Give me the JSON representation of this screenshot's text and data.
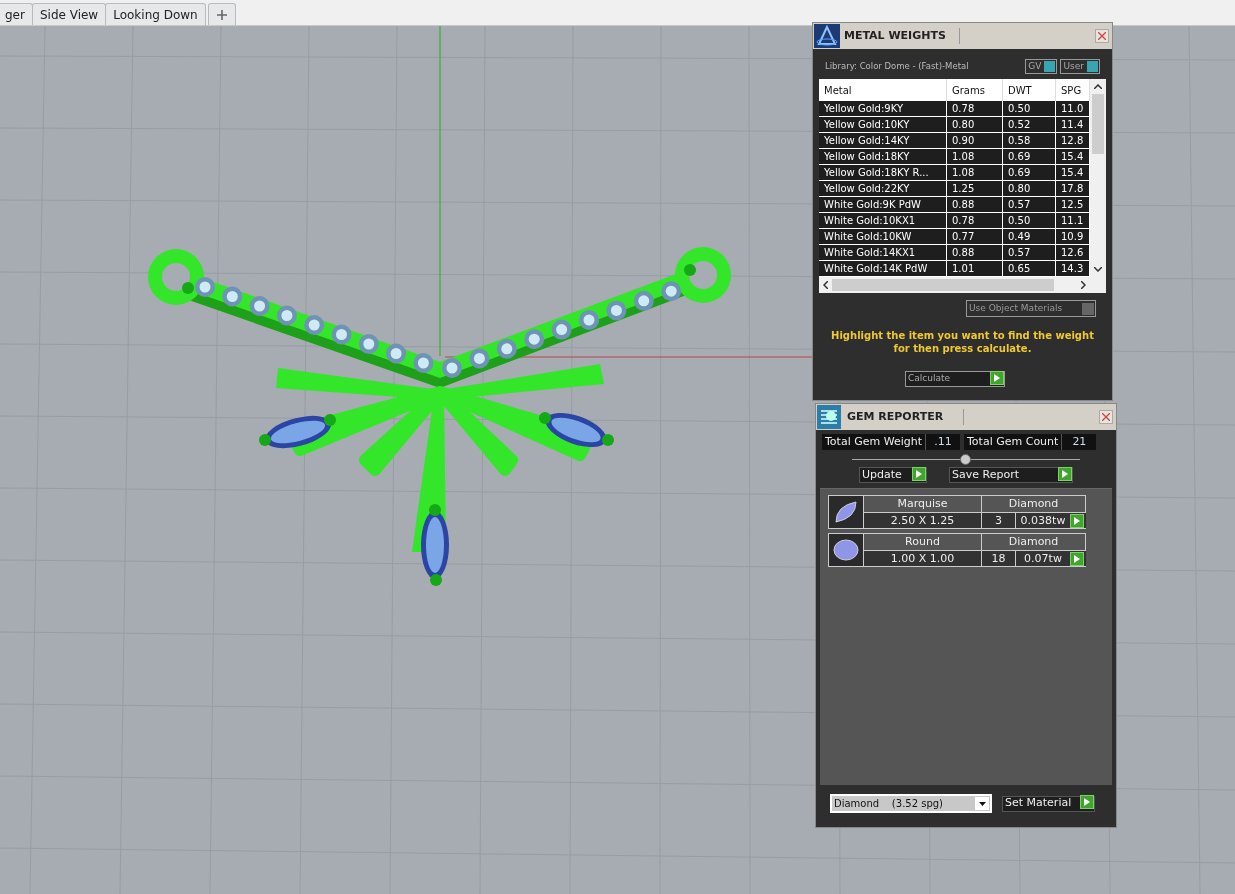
{
  "tabs": [
    {
      "label": "ger"
    },
    {
      "label": "Side View"
    },
    {
      "label": "Looking Down"
    }
  ],
  "metal_weights": {
    "title": "METAL WEIGHTS",
    "library": "Library: Color Dome - (Fast)-Metal",
    "toggles": [
      {
        "label": "GV",
        "on": true
      },
      {
        "label": "User",
        "on": true
      }
    ],
    "columns": [
      "Metal",
      "Grams",
      "DWT",
      "SPG"
    ],
    "rows": [
      [
        "Yellow Gold:9KY",
        "0.78",
        "0.50",
        "11.0"
      ],
      [
        "Yellow Gold:10KY",
        "0.80",
        "0.52",
        "11.4"
      ],
      [
        "Yellow Gold:14KY",
        "0.90",
        "0.58",
        "12.8"
      ],
      [
        "Yellow Gold:18KY",
        "1.08",
        "0.69",
        "15.4"
      ],
      [
        "Yellow Gold:18KY R...",
        "1.08",
        "0.69",
        "15.4"
      ],
      [
        "Yellow Gold:22KY",
        "1.25",
        "0.80",
        "17.8"
      ],
      [
        "White Gold:9K PdW",
        "0.88",
        "0.57",
        "12.5"
      ],
      [
        "White Gold:10KX1",
        "0.78",
        "0.50",
        "11.1"
      ],
      [
        "White Gold:10KW",
        "0.77",
        "0.49",
        "10.9"
      ],
      [
        "White Gold:14KX1",
        "0.88",
        "0.57",
        "12.6"
      ],
      [
        "White Gold:14K PdW",
        "1.01",
        "0.65",
        "14.3"
      ]
    ],
    "use_object_materials": {
      "label": "Use Object Materials",
      "checked": false
    },
    "hint": "Highlight the item you want to find the weight for then press calculate.",
    "calculate": "Calculate"
  },
  "gem_reporter": {
    "title": "GEM REPORTER",
    "total_weight_label": "Total Gem Weight",
    "total_weight": ".11",
    "total_count_label": "Total Gem Count",
    "total_count": "21",
    "update": "Update",
    "save_report": "Save Report",
    "gems": [
      {
        "kind": "marquise",
        "shape": "Marquise",
        "size": "2.50 X 1.25",
        "material": "Diamond",
        "count": "3",
        "weight": "0.038tw"
      },
      {
        "kind": "round",
        "shape": "Round",
        "size": "1.00 X 1.00",
        "material": "Diamond",
        "count": "18",
        "weight": "0.07tw"
      }
    ],
    "material": "Diamond    (3.52 spg)",
    "set_material": "Set Material"
  }
}
